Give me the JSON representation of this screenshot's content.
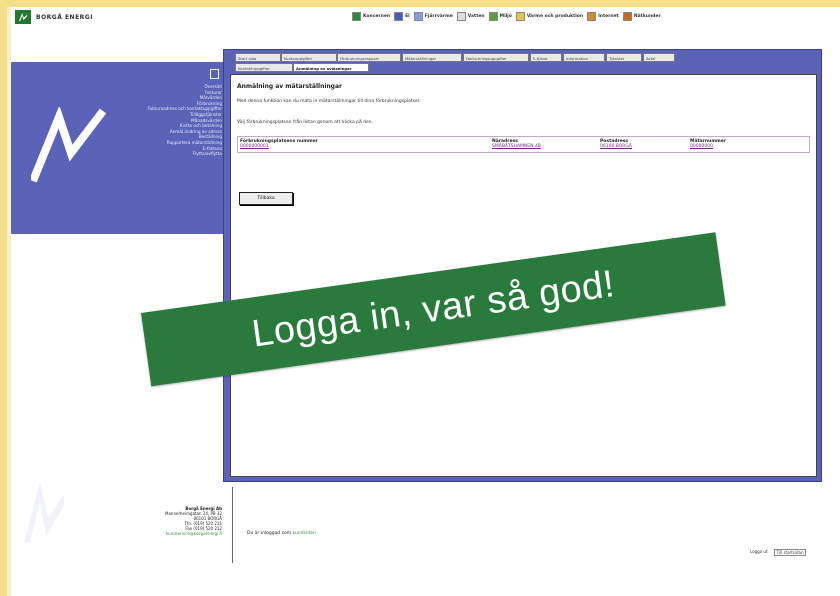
{
  "header": {
    "logo_text": "BORGÅ ENERGI",
    "nav": [
      {
        "label": "Koncernen",
        "icon": "green-square",
        "color": "#2f8a3a"
      },
      {
        "label": "El",
        "icon": "blue-square",
        "color": "#4a5bbd"
      },
      {
        "label": "Fjärrvärme",
        "icon": "blue-outline-square",
        "color": "#8a9bdd"
      },
      {
        "label": "Vatten",
        "icon": "white-square",
        "color": "#dddddd"
      },
      {
        "label": "Miljö",
        "icon": "green-square",
        "color": "#58a63a"
      },
      {
        "label": "Värme och produktion",
        "icon": "yellow-square",
        "color": "#e0c84a"
      },
      {
        "label": "Internet",
        "icon": "orange-square",
        "color": "#d08a2a"
      },
      {
        "label": "Nätkunder",
        "icon": "orange-square",
        "color": "#c96a1a"
      }
    ]
  },
  "sidebar": {
    "collapse_icon": "collapse-icon",
    "menu": [
      "Översikt",
      "Fakturor",
      "Mätvärden",
      "Förbrukning",
      "Fakturaadress och kontaktuppgifter",
      "Tilläggstjänster",
      "Månadsvärden",
      "Kvitto och betalning",
      "Anmäl ändring av adress",
      "Beställning",
      "Rapportera mätarställning",
      "E-faktura",
      "Flytta/avflytta"
    ],
    "address": {
      "company": "Borgå Energi Ab",
      "street": "Mannerheimgatan 24, PB 32",
      "city": "06101 BORGÅ",
      "phone": "Tfn. (019) 520 211",
      "fax": "Fax (019) 520 212",
      "email": "kundservice@borgaenergi.fi"
    }
  },
  "tabs": [
    "Start sida",
    "Kontouppgifter",
    "Förbrukningsrapport",
    "Mätarställningar",
    "Faktureringsuppgifter",
    "E-tjänst",
    "Information",
    "Tjänster",
    "Avtal",
    "Kontaktuppgifter",
    "Anmälning av avläsningar"
  ],
  "active_tab": "Anmälning av avläsningar",
  "content": {
    "title": "Anmälning av mätarställningar",
    "description": "Med denna funktion kan du mata in mätarställningar till dina förbrukningsplatser.",
    "instruction": "Välj förbrukningsplatsen från listan genom att klicka på den.",
    "table": {
      "headers": [
        "Förbrukningsplatsens nummer",
        "Näradress",
        "Postadress",
        "Mätarnummer"
      ],
      "rows": [
        [
          "0000000001",
          "SMÅBÅTSHAMNEN 4B",
          "06100 BORGÅ",
          "00000000"
        ]
      ]
    },
    "back_button": "Tillbaka"
  },
  "footer": {
    "logged_in_label": "Du är inloggad som",
    "user_link": "kundsidan",
    "bottom_links": [
      "Logga ut",
      "Till startsidan"
    ]
  },
  "banner": {
    "text": "Logga in, var så god!",
    "color": "#2a7a3d"
  }
}
